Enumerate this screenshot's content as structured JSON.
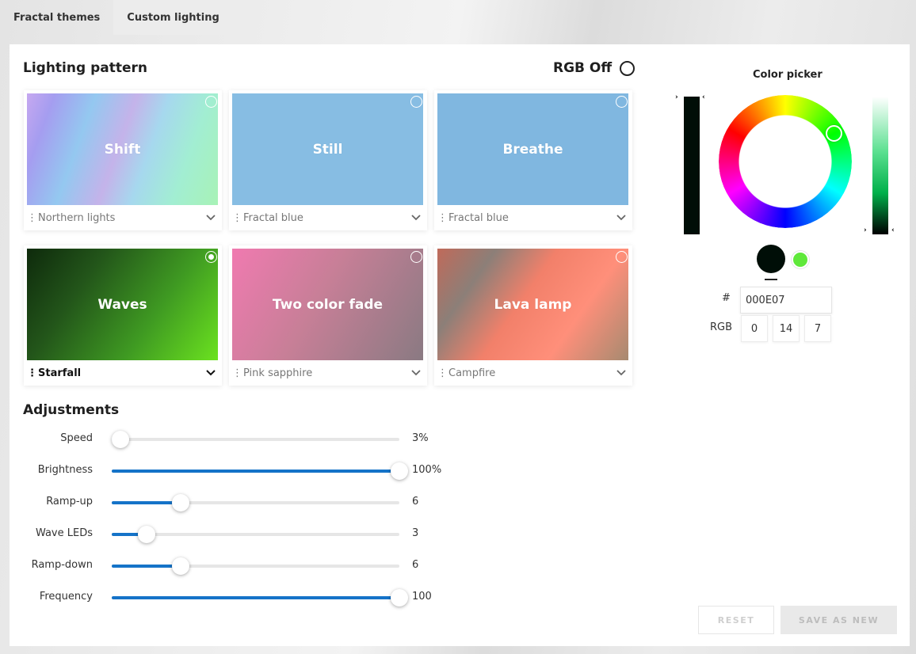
{
  "tabs": [
    "Fractal themes",
    "Custom lighting"
  ],
  "lighting": {
    "title": "Lighting pattern",
    "rgb_off": "RGB Off",
    "cards": [
      {
        "pattern": "Shift",
        "preset": "Northern lights",
        "selected": false
      },
      {
        "pattern": "Still",
        "preset": "Fractal blue",
        "selected": false
      },
      {
        "pattern": "Breathe",
        "preset": "Fractal blue",
        "selected": false
      },
      {
        "pattern": "Waves",
        "preset": "Starfall",
        "selected": true
      },
      {
        "pattern": "Two color fade",
        "preset": "Pink sapphire",
        "selected": false
      },
      {
        "pattern": "Lava lamp",
        "preset": "Campfire",
        "selected": false
      }
    ]
  },
  "adjustments": {
    "title": "Adjustments",
    "rows": [
      {
        "label": "Speed",
        "value": "3%",
        "level": 0.03
      },
      {
        "label": "Brightness",
        "value": "100%",
        "level": 1.0
      },
      {
        "label": "Ramp-up",
        "value": "6",
        "level": 0.24
      },
      {
        "label": "Wave LEDs",
        "value": "3",
        "level": 0.12
      },
      {
        "label": "Ramp-down",
        "value": "6",
        "level": 0.24
      },
      {
        "label": "Frequency",
        "value": "100",
        "level": 1.0
      }
    ]
  },
  "color_picker": {
    "title": "Color picker",
    "hex_label": "#",
    "hex_value": "000E07",
    "rgb_label": "RGB",
    "rgb": [
      "0",
      "14",
      "7"
    ],
    "primary_color": "#000e07",
    "secondary_color": "#5fe83a"
  },
  "buttons": {
    "reset": "RESET",
    "save_as_new": "SAVE AS NEW"
  },
  "colors": {
    "accent": "#1573c8"
  }
}
